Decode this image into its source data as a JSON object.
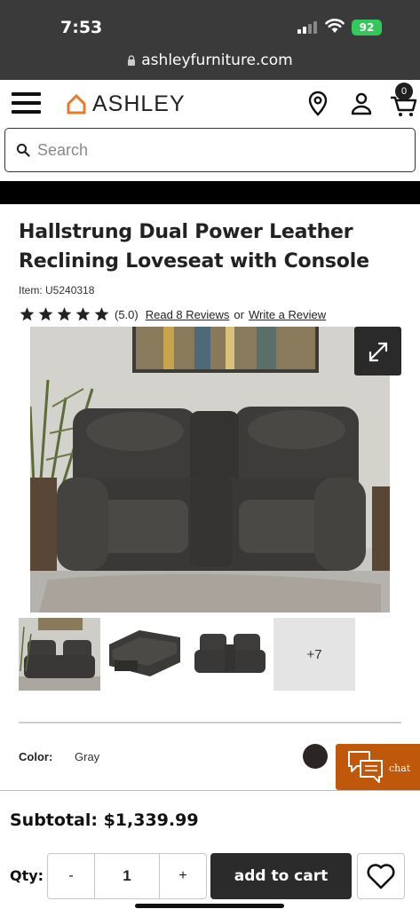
{
  "status_bar": {
    "time": "7:53",
    "battery": "92"
  },
  "browser": {
    "url": "ashleyfurniture.com"
  },
  "header": {
    "logo_text": "ASHLEY",
    "cart_count": "0"
  },
  "search": {
    "placeholder": "Search"
  },
  "product": {
    "title": "Hallstrung Dual Power Leather Reclining Loveseat with Console",
    "item_number": "Item: U5240318",
    "rating": 5.0,
    "rating_text": "(5.0)",
    "reviews_link": "Read 8 Reviews",
    "or_text": "or",
    "write_review_link": "Write a Review",
    "more_images": "+7",
    "color_label": "Color:",
    "color_value": "Gray",
    "swatch_color": "#2b2624"
  },
  "chat": {
    "label": "chat"
  },
  "footer": {
    "subtotal": "Subtotal: $1,339.99",
    "qty_label": "Qty:",
    "decrement": "-",
    "quantity": "1",
    "increment": "+",
    "add_to_cart": "add to cart"
  },
  "colors": {
    "accent": "#e8782a",
    "chat_bg": "#c0580c",
    "dark": "#2b2b2b"
  }
}
